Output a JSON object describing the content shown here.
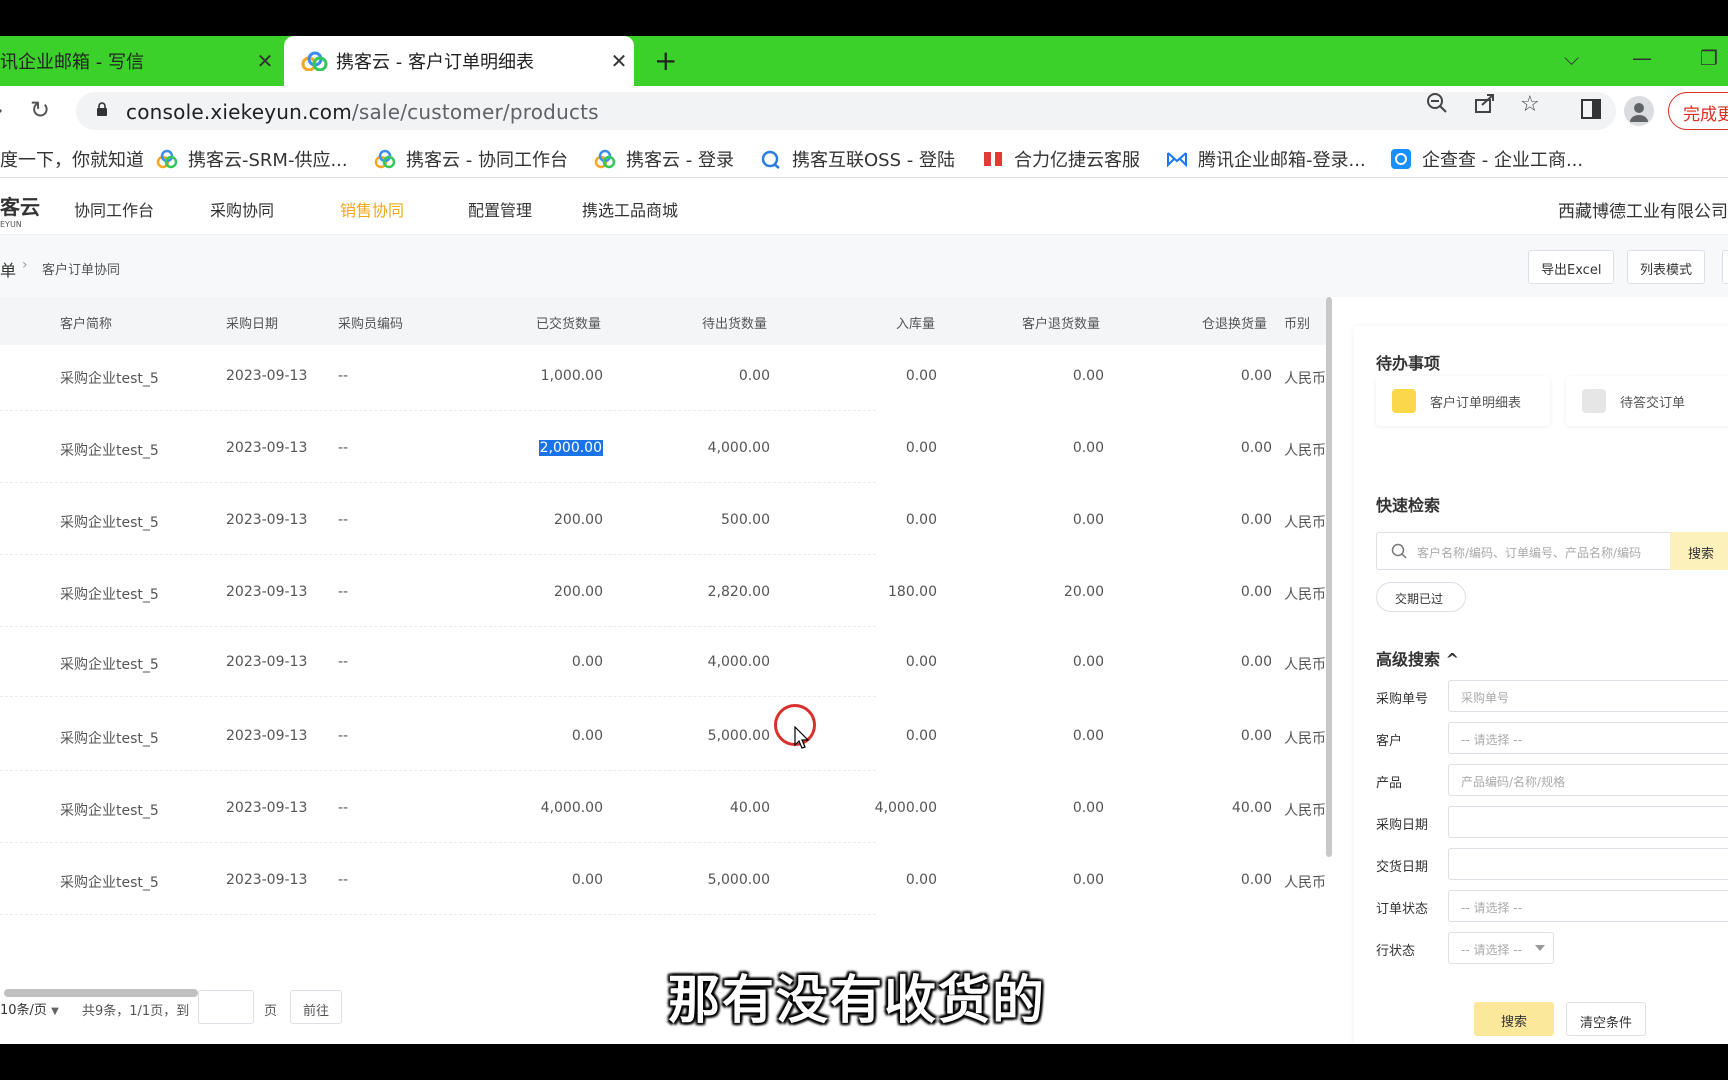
{
  "browser": {
    "tabs": [
      {
        "title": "讯企业邮箱 - 写信",
        "active": false
      },
      {
        "title": "携客云 - 客户订单明细表",
        "active": true
      }
    ],
    "new_tab": "+",
    "url_host": "console.xiekeyun.com",
    "url_path": "/sale/customer/products",
    "finish_label": "完成更",
    "bookmarks": [
      {
        "label": "度一下，你就知道",
        "icon": "none"
      },
      {
        "label": "携客云-SRM-供应...",
        "icon": "xiekeyun-logo-icon"
      },
      {
        "label": "携客云 - 协同工作台",
        "icon": "xiekeyun-logo-icon"
      },
      {
        "label": "携客云 - 登录",
        "icon": "xiekeyun-logo-icon"
      },
      {
        "label": "携客互联OSS - 登陆",
        "icon": "oss-logo-icon"
      },
      {
        "label": "合力亿捷云客服",
        "icon": "heli-logo-icon"
      },
      {
        "label": "腾讯企业邮箱-登录...",
        "icon": "tencent-mail-icon"
      },
      {
        "label": "企查查 - 企业工商...",
        "icon": "qichacha-icon"
      }
    ]
  },
  "app": {
    "logo": "客云",
    "logo_sub": "EYUN",
    "nav": [
      "协同工作台",
      "采购协同",
      "销售协同",
      "配置管理",
      "携选工品商城"
    ],
    "active_nav": "销售协同",
    "company": "西藏博德工业有限公司",
    "breadcrumb_root": "单",
    "breadcrumb_current": "客户订单协同",
    "export_label": "导出Excel",
    "list_mode_label": "列表模式"
  },
  "table": {
    "columns": [
      "客户简称",
      "采购日期",
      "采购员编码",
      "已交货数量",
      "待出货数量",
      "入库量",
      "客户退货数量",
      "仓退换货量",
      "币别"
    ],
    "rows": [
      [
        "采购企业test_5",
        "2023-09-13",
        "--",
        "1,000.00",
        "0.00",
        "0.00",
        "0.00",
        "0.00",
        "人民币"
      ],
      [
        "采购企业test_5",
        "2023-09-13",
        "--",
        "2,000.00",
        "4,000.00",
        "0.00",
        "0.00",
        "0.00",
        "人民币"
      ],
      [
        "采购企业test_5",
        "2023-09-13",
        "--",
        "200.00",
        "500.00",
        "0.00",
        "0.00",
        "0.00",
        "人民币"
      ],
      [
        "采购企业test_5",
        "2023-09-13",
        "--",
        "200.00",
        "2,820.00",
        "180.00",
        "20.00",
        "0.00",
        "人民币"
      ],
      [
        "采购企业test_5",
        "2023-09-13",
        "--",
        "0.00",
        "4,000.00",
        "0.00",
        "0.00",
        "0.00",
        "人民币"
      ],
      [
        "采购企业test_5",
        "2023-09-13",
        "--",
        "0.00",
        "5,000.00",
        "0.00",
        "0.00",
        "0.00",
        "人民币"
      ],
      [
        "采购企业test_5",
        "2023-09-13",
        "--",
        "4,000.00",
        "40.00",
        "4,000.00",
        "0.00",
        "40.00",
        "人民币"
      ],
      [
        "采购企业test_5",
        "2023-09-13",
        "--",
        "0.00",
        "5,000.00",
        "0.00",
        "0.00",
        "0.00",
        "人民币"
      ]
    ]
  },
  "pager": {
    "page_size": "10条/页",
    "summary": "共9条，1/1页，到",
    "page_unit": "页",
    "go": "前往"
  },
  "panel": {
    "todo_title": "待办事项",
    "todo_items": [
      "客户订单明细表",
      "待答交订单"
    ],
    "quick_title": "快速检索",
    "quick_placeholder": "客户名称/编码、订单编号、产品名称/编码",
    "quick_btn": "搜索",
    "tag_overdue": "交期已过",
    "adv_title": "高级搜索 ^",
    "fields": {
      "po_label": "采购单号",
      "po_placeholder": "采购单号",
      "customer_label": "客户",
      "customer_placeholder": "-- 请选择 --",
      "product_label": "产品",
      "product_placeholder": "产品编码/名称/规格",
      "pdate_label": "采购日期",
      "ddate_label": "交货日期",
      "ostatus_label": "订单状态",
      "ostatus_placeholder": "-- 请选择 --",
      "rstatus_label": "行状态",
      "rstatus_placeholder": "-- 请选择 --"
    },
    "search_btn": "搜索",
    "clear_btn": "清空条件"
  },
  "subtitle": "那有没有收货的",
  "colors": {
    "tab_strip": "#3cd12a",
    "accent_nav": "#f0a71a",
    "search_btn": "#fdf1bb",
    "selection": "#1a73e8"
  }
}
